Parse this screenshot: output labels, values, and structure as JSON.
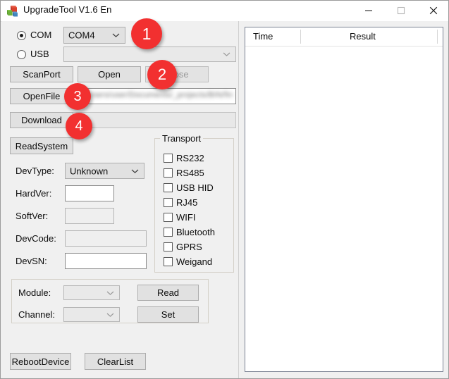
{
  "window": {
    "title": "UpgradeTool V1.6 En",
    "icon": "app-blocks-icon",
    "controls": [
      {
        "name": "minimize",
        "glyph": "minimize-icon",
        "enabled": true
      },
      {
        "name": "maximize",
        "glyph": "maximize-icon",
        "enabled": false
      },
      {
        "name": "close",
        "glyph": "close-icon",
        "enabled": true
      }
    ]
  },
  "connection": {
    "com_radio_label": "COM",
    "com_radio_selected": true,
    "com_port_value": "COM4",
    "usb_radio_label": "USB",
    "usb_radio_selected": false,
    "usb_device_value": ""
  },
  "buttons": {
    "scan_port": "ScanPort",
    "open": "Open",
    "close": "Close",
    "close_enabled": false,
    "open_file": "OpenFile",
    "download": "Download",
    "read_system": "ReadSystem",
    "read": "Read",
    "set": "Set",
    "reboot_device": "RebootDevice",
    "clear_list": "ClearList"
  },
  "file": {
    "path_value": "C:/Users/user/Documents/_projects/BIN/firmware_upgrade_v16.bin",
    "path_redacted": true
  },
  "device_info": {
    "dev_type_label": "DevType:",
    "dev_type_value": "Unknown",
    "hard_ver_label": "HardVer:",
    "hard_ver_value": "",
    "soft_ver_label": "SoftVer:",
    "soft_ver_value": "",
    "dev_code_label": "DevCode:",
    "dev_code_value": "",
    "dev_sn_label": "DevSN:",
    "dev_sn_value": ""
  },
  "transport": {
    "title": "Transport",
    "options": [
      {
        "label": "RS232",
        "checked": false
      },
      {
        "label": "RS485",
        "checked": false
      },
      {
        "label": "USB HID",
        "checked": false
      },
      {
        "label": "RJ45",
        "checked": false
      },
      {
        "label": "WIFI",
        "checked": false
      },
      {
        "label": "Bluetooth",
        "checked": false
      },
      {
        "label": "GPRS",
        "checked": false
      },
      {
        "label": "Weigand",
        "checked": false
      }
    ]
  },
  "module_panel": {
    "module_label": "Module:",
    "module_value": "",
    "channel_label": "Channel:",
    "channel_value": ""
  },
  "log_list": {
    "columns": [
      "Time",
      "Result"
    ],
    "rows": []
  },
  "annotations": {
    "badge_color": "#F23030",
    "items": [
      {
        "number": "1",
        "target": "com-port-combo"
      },
      {
        "number": "2",
        "target": "close-button"
      },
      {
        "number": "3",
        "target": "open-file-button"
      },
      {
        "number": "4",
        "target": "download-button"
      }
    ]
  }
}
